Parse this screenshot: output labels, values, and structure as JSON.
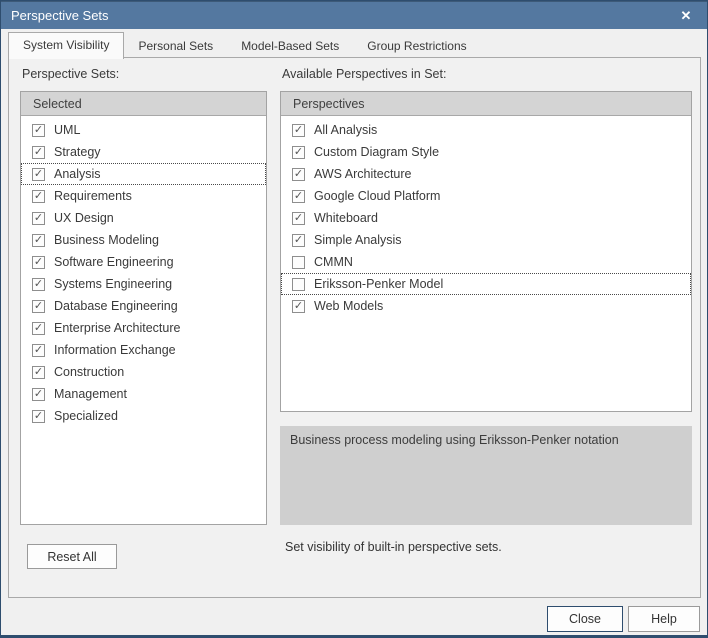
{
  "window": {
    "title": "Perspective Sets",
    "close_icon": "✕"
  },
  "tabs": [
    {
      "label": "System Visibility",
      "active": true
    },
    {
      "label": "Personal Sets",
      "active": false
    },
    {
      "label": "Model-Based Sets",
      "active": false
    },
    {
      "label": "Group Restrictions",
      "active": false
    }
  ],
  "left_panel": {
    "label": "Perspective Sets:",
    "header": "Selected",
    "items": [
      {
        "label": "UML",
        "checked": true,
        "focused": false
      },
      {
        "label": "Strategy",
        "checked": true,
        "focused": false
      },
      {
        "label": "Analysis",
        "checked": true,
        "focused": true
      },
      {
        "label": "Requirements",
        "checked": true,
        "focused": false
      },
      {
        "label": "UX Design",
        "checked": true,
        "focused": false
      },
      {
        "label": "Business Modeling",
        "checked": true,
        "focused": false
      },
      {
        "label": "Software Engineering",
        "checked": true,
        "focused": false
      },
      {
        "label": "Systems Engineering",
        "checked": true,
        "focused": false
      },
      {
        "label": "Database Engineering",
        "checked": true,
        "focused": false
      },
      {
        "label": "Enterprise Architecture",
        "checked": true,
        "focused": false
      },
      {
        "label": "Information Exchange",
        "checked": true,
        "focused": false
      },
      {
        "label": "Construction",
        "checked": true,
        "focused": false
      },
      {
        "label": "Management",
        "checked": true,
        "focused": false
      },
      {
        "label": "Specialized",
        "checked": true,
        "focused": false
      }
    ]
  },
  "right_panel": {
    "label": "Available Perspectives in Set:",
    "header": "Perspectives",
    "items": [
      {
        "label": "All Analysis",
        "checked": true,
        "focused": false
      },
      {
        "label": "Custom Diagram Style",
        "checked": true,
        "focused": false
      },
      {
        "label": "AWS Architecture",
        "checked": true,
        "focused": false
      },
      {
        "label": "Google Cloud Platform",
        "checked": true,
        "focused": false
      },
      {
        "label": "Whiteboard",
        "checked": true,
        "focused": false
      },
      {
        "label": "Simple Analysis",
        "checked": true,
        "focused": false
      },
      {
        "label": "CMMN",
        "checked": false,
        "focused": false
      },
      {
        "label": "Eriksson-Penker Model",
        "checked": false,
        "focused": true
      },
      {
        "label": "Web Models",
        "checked": true,
        "focused": false
      }
    ]
  },
  "description": "Business process modeling using Eriksson-Penker notation",
  "hint": "Set visibility of built-in perspective sets.",
  "buttons": {
    "reset": "Reset All",
    "close": "Close",
    "help": "Help"
  },
  "colors": {
    "titlebar": "#5478a0",
    "window_border": "#2e4d6e",
    "header_bg": "#d4d4d4",
    "description_bg": "#cfcfcf",
    "check_mark": "✓"
  }
}
